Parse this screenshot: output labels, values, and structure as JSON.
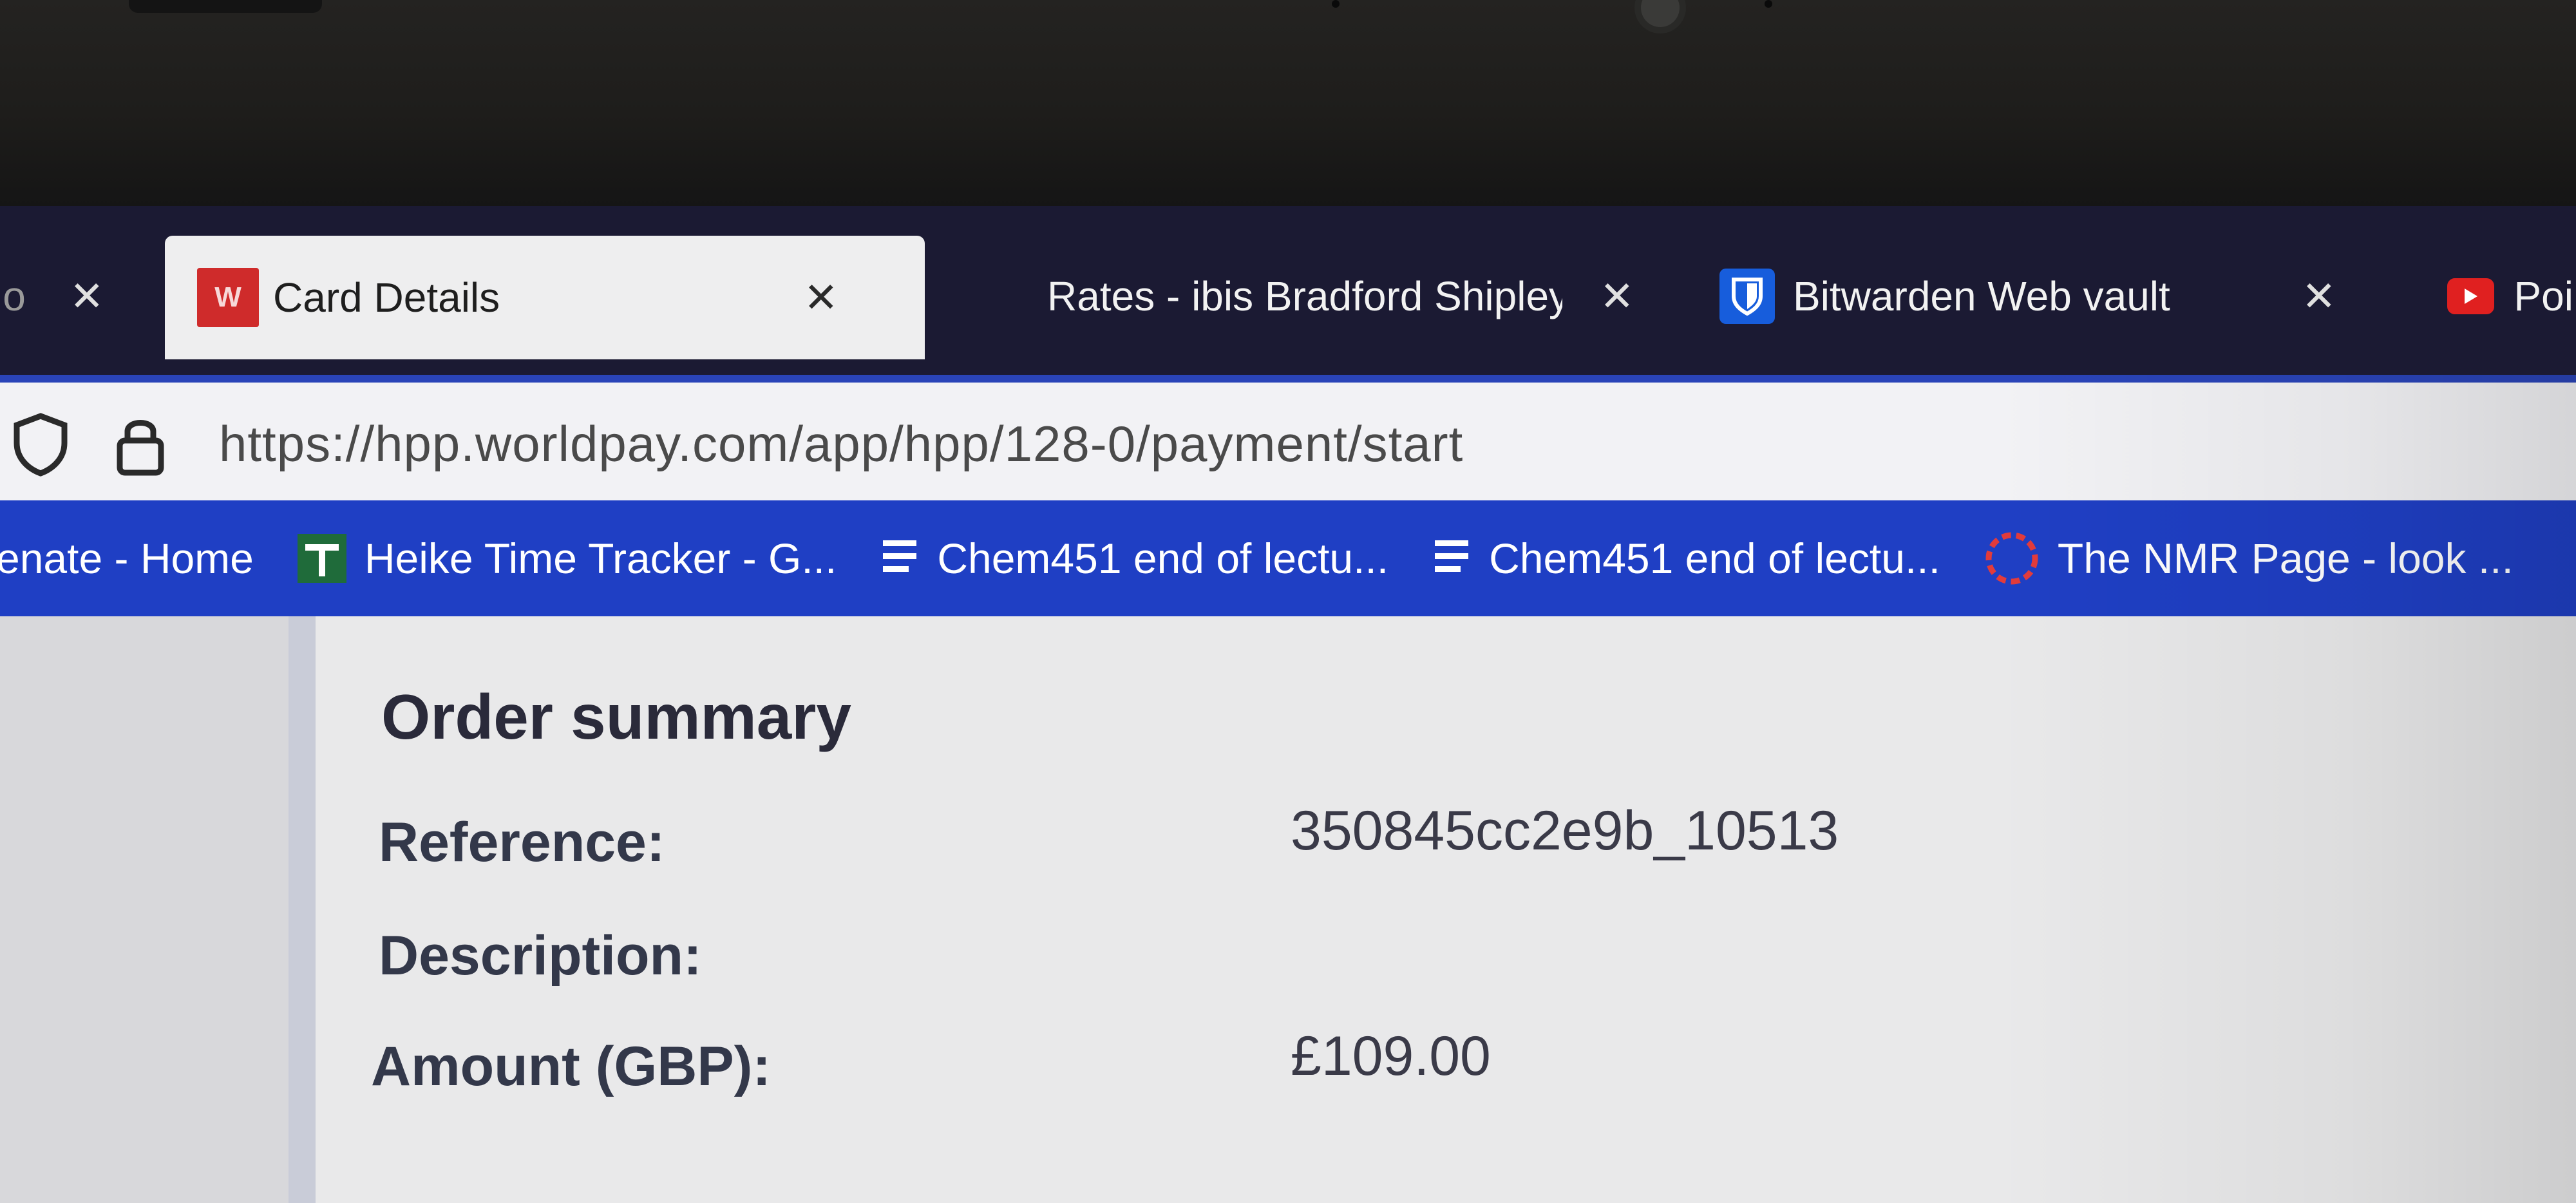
{
  "tabs": [
    {
      "label": "lo",
      "active": false
    },
    {
      "label": "Card Details",
      "active": true,
      "icon": "worldpay-icon"
    },
    {
      "label": "Rates - ibis Bradford Shipley",
      "active": false
    },
    {
      "label": "Bitwarden Web vault",
      "active": false,
      "icon": "bitwarden-icon"
    },
    {
      "label": "Poi",
      "active": false,
      "icon": "youtube-icon"
    }
  ],
  "address_bar": {
    "url": "https://hpp.worldpay.com/app/hpp/128-0/payment/start"
  },
  "bookmarks": [
    {
      "label": "enate - Home"
    },
    {
      "label": "Heike Time Tracker - G...",
      "icon": "sheets-icon"
    },
    {
      "label": "Chem451 end of lectu...",
      "icon": "docs-icon"
    },
    {
      "label": "Chem451 end of lectu...",
      "icon": "docs-icon"
    },
    {
      "label": "The NMR Page - look ...",
      "icon": "nmr-icon"
    }
  ],
  "order_summary": {
    "title": "Order summary",
    "reference_label": "Reference:",
    "reference_value": "350845cc2e9b_10513",
    "description_label": "Description:",
    "description_value": "",
    "amount_label": "Amount (GBP):",
    "amount_value": "£109.00"
  },
  "colors": {
    "tabstrip": "#1b1a33",
    "bookmarks_bar": "#1f3fc4",
    "worldpay_red": "#cf2b2b",
    "bitwarden_blue": "#175ddc"
  }
}
